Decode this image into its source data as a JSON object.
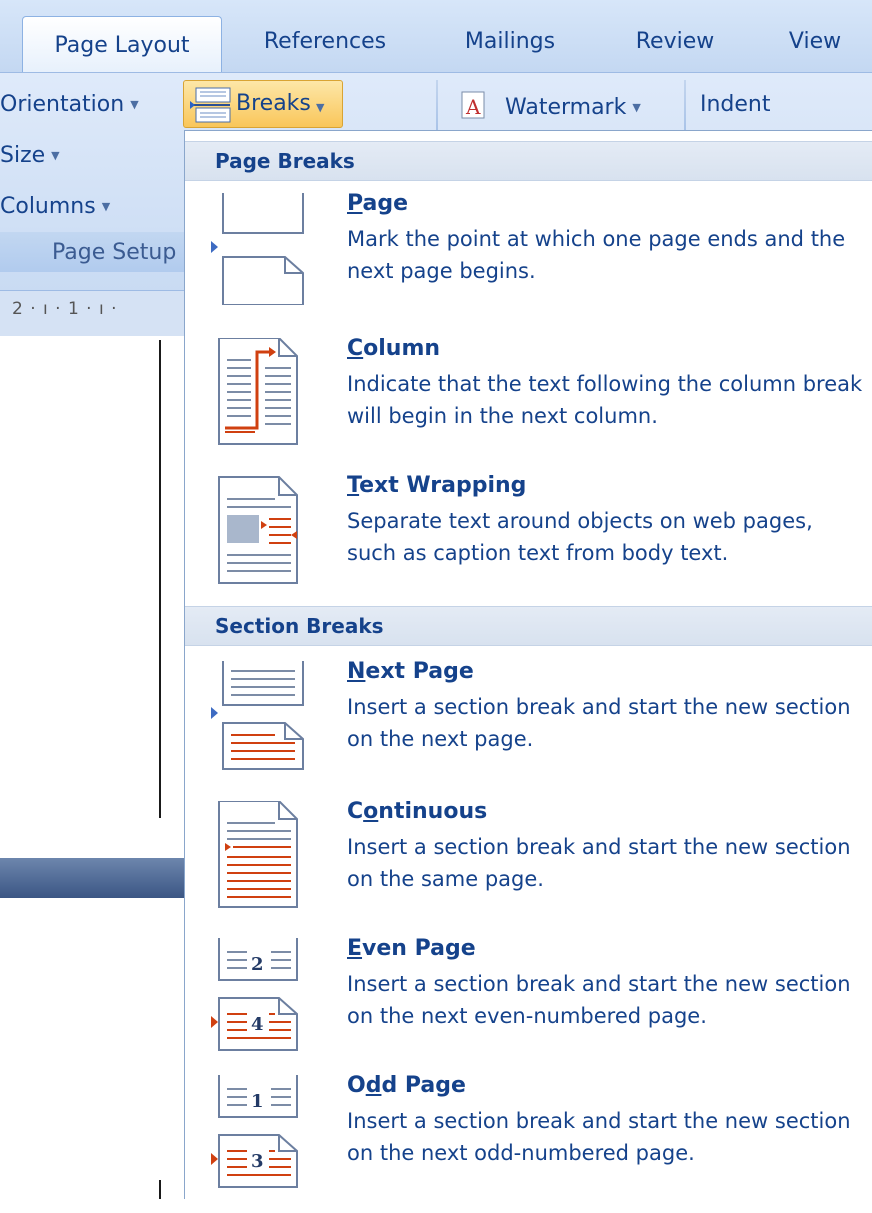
{
  "tabs": [
    {
      "label": "Page Layout",
      "active": true
    },
    {
      "label": "References",
      "active": false
    },
    {
      "label": "Mailings",
      "active": false
    },
    {
      "label": "Review",
      "active": false
    },
    {
      "label": "View",
      "active": false
    }
  ],
  "ribbon": {
    "orientation": "Orientation",
    "size": "Size",
    "columns": "Columns",
    "breaks": "Breaks",
    "watermark": "Watermark",
    "indent": "Indent",
    "group_label": "Page Setup",
    "ruler_text": "2 · ı · 1 · ı ·"
  },
  "menu": {
    "page_breaks_header": "Page Breaks",
    "section_breaks_header": "Section Breaks",
    "items": [
      {
        "title_ul": "P",
        "title_rest": "age",
        "desc": "Mark the point at which one page ends and the next page begins.",
        "icon": "page-break-icon"
      },
      {
        "title_ul": "C",
        "title_rest": "olumn",
        "desc": "Indicate that the text following the column break will begin in the next column.",
        "icon": "column-break-icon"
      },
      {
        "title_ul": "T",
        "title_rest": "ext Wrapping",
        "desc": "Separate text around objects on web pages, such as caption text from body text.",
        "icon": "text-wrapping-icon"
      },
      {
        "title_ul": "N",
        "title_rest": "ext Page",
        "desc": "Insert a section break and start the new section on the next page.",
        "icon": "next-page-icon"
      },
      {
        "title_pre": "C",
        "title_ul": "o",
        "title_rest": "ntinuous",
        "desc": "Insert a section break and start the new section on the same page.",
        "icon": "continuous-icon"
      },
      {
        "title_ul": "E",
        "title_rest": "ven Page",
        "desc": "Insert a section break and start the new section on the next even-numbered page.",
        "icon": "even-page-icon"
      },
      {
        "title_pre": "O",
        "title_ul": "d",
        "title_rest": "d Page",
        "desc": "Insert a section break and start the new section on the next odd-numbered page.",
        "icon": "odd-page-icon"
      }
    ]
  },
  "icon_numbers": {
    "even_top": "2",
    "even_bottom": "4",
    "odd_top": "1",
    "odd_bottom": "3"
  },
  "colors": {
    "accent": "#15428b",
    "highlight": "#f9c65a",
    "break_red": "#d04010"
  }
}
